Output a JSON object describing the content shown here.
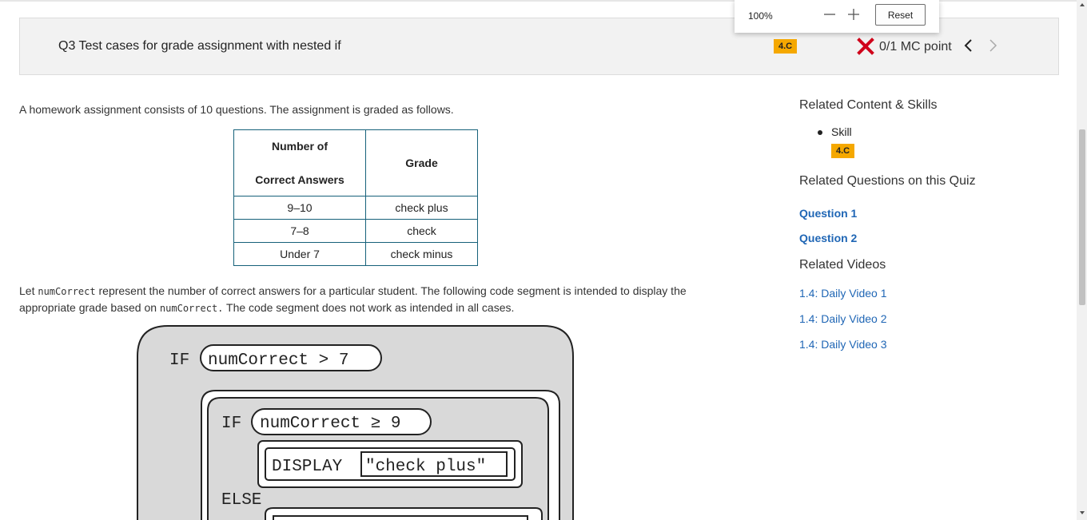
{
  "zoom": {
    "level": "100%",
    "reset_label": "Reset"
  },
  "question": {
    "title": "Q3 Test cases for grade assignment with nested if",
    "skill": "4.C",
    "score": "0/1 MC point"
  },
  "content": {
    "intro": "A homework assignment consists of 10 questions. The assignment is graded as follows.",
    "table": {
      "header_col1_line1": "Number of",
      "header_col1_line2": "Correct Answers",
      "header_col2": "Grade",
      "rows": [
        {
          "range": "9–10",
          "grade": "check plus"
        },
        {
          "range": "7–8",
          "grade": "check"
        },
        {
          "range": "Under 7",
          "grade": "check minus"
        }
      ]
    },
    "para_part1": "Let",
    "para_code1": "numCorrect",
    "para_part2": "represent the number of correct answers for a particular student. The following code segment is intended to display the appropriate grade based on",
    "para_code2": "numCorrect.",
    "para_part3": "The code segment does not work as intended in all cases.",
    "diagram": {
      "if1_keyword": "IF",
      "if1_condition": "numCorrect > 7",
      "if2_keyword": "IF",
      "if2_condition": "numCorrect ≥ 9",
      "display_keyword": "DISPLAY",
      "display_value": "\"check plus\"",
      "else_keyword": "ELSE"
    }
  },
  "sidebar": {
    "related_heading": "Related Content & Skills",
    "skill_label": "Skill",
    "skill_badge": "4.C",
    "questions_heading": "Related Questions on this Quiz",
    "questions": [
      "Question 1",
      "Question 2"
    ],
    "videos_heading": "Related Videos",
    "videos": [
      "1.4: Daily Video 1",
      "1.4: Daily Video 2",
      "1.4: Daily Video 3"
    ]
  },
  "colors": {
    "badge": "#f5a800",
    "link": "#1f66b5",
    "incorrect": "#d0021b",
    "table_border": "#16617a"
  }
}
